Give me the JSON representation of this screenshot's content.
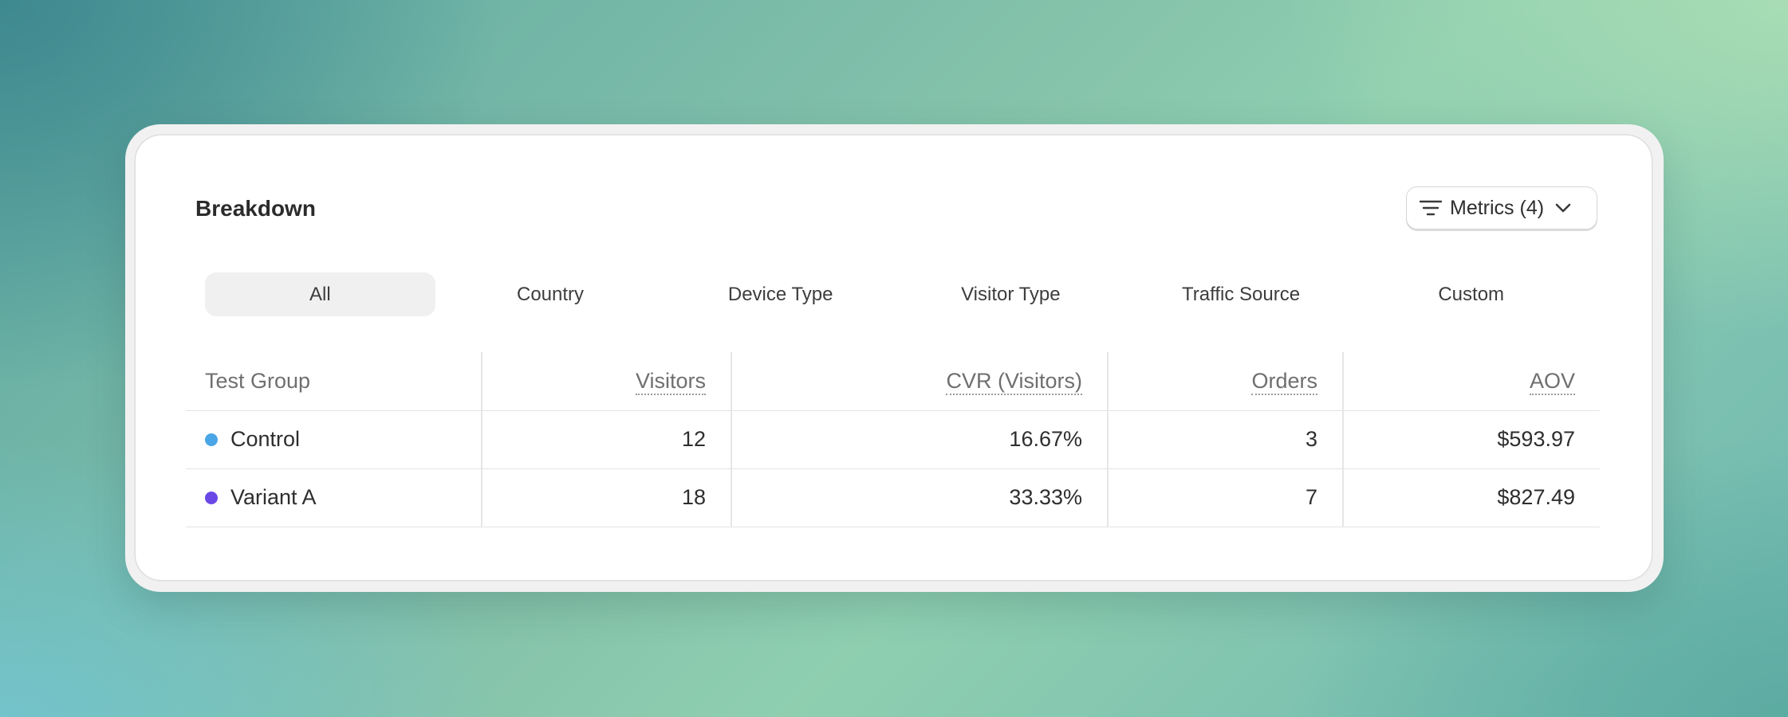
{
  "card": {
    "title": "Breakdown",
    "metrics_button": {
      "label": "Metrics (4)",
      "icon": "filter-icon",
      "chevron": "chevron-down-icon"
    }
  },
  "tabs": [
    {
      "label": "All",
      "active": true
    },
    {
      "label": "Country",
      "active": false
    },
    {
      "label": "Device Type",
      "active": false
    },
    {
      "label": "Visitor Type",
      "active": false
    },
    {
      "label": "Traffic Source",
      "active": false
    },
    {
      "label": "Custom",
      "active": false
    }
  ],
  "table": {
    "headers": [
      "Test Group",
      "Visitors",
      "CVR (Visitors)",
      "Orders",
      "AOV"
    ],
    "rows": [
      {
        "group": "Control",
        "color": "#4aa6e6",
        "visitors": "12",
        "cvr": "16.67%",
        "orders": "3",
        "aov": "$593.97"
      },
      {
        "group": "Variant A",
        "color": "#6a48e8",
        "visitors": "18",
        "cvr": "33.33%",
        "orders": "7",
        "aov": "$827.49"
      }
    ]
  }
}
